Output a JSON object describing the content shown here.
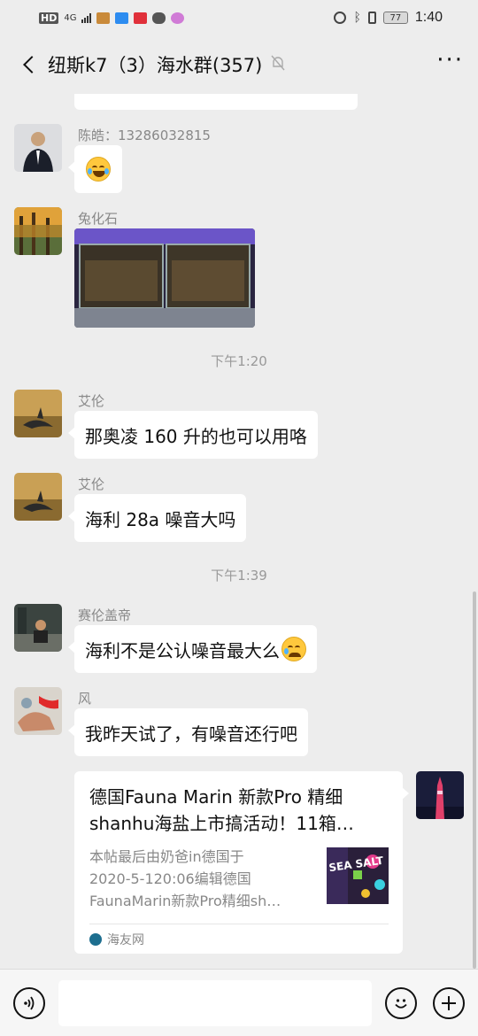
{
  "status_bar": {
    "network_label": "HD",
    "signal_label": "4G",
    "battery": "77",
    "time": "1:40"
  },
  "header": {
    "title": "纽斯k7（3）海水群(357)",
    "back_icon": "chevron-left-icon",
    "mute_icon": "bell-muted-icon",
    "more_icon": "ellipsis-icon"
  },
  "messages": {
    "m1": {
      "sender": "陈皓：13286032815",
      "type": "emoji",
      "emoji": "laugh-tears"
    },
    "m2": {
      "sender": "兔化石",
      "type": "image"
    },
    "time1": "下午1:20",
    "m3": {
      "sender": "艾伦",
      "text": "那奥凌 160 升的也可以用咯"
    },
    "m4": {
      "sender": "艾伦",
      "text": "海利 28a 噪音大吗"
    },
    "time2": "下午1:39",
    "m5": {
      "sender": "赛伦盖帝",
      "text": "海利不是公认噪音最大么",
      "emoji": "crying"
    },
    "m6": {
      "sender": "风",
      "text": "我昨天试了，有噪音还行吧"
    },
    "m7": {
      "type": "link",
      "title_line1": "德国Fauna Marin 新款Pro 精细",
      "title_line2": "shanhu海盐上市搞活动！11箱…",
      "desc_line1": "本帖最后由奶爸in德国于",
      "desc_line2": "2020-5-120:06编辑德国",
      "desc_line3": "FaunaMarin新款Pro精细sh…",
      "source": "海友网",
      "thumb_text": "SEA SALT"
    }
  },
  "input_bar": {
    "voice_icon": "voice-icon",
    "emoji_icon": "smiley-icon",
    "plus_icon": "plus-icon",
    "placeholder": ""
  },
  "colors": {
    "background": "#ededed",
    "bubble": "#ffffff",
    "meta_text": "#888888"
  }
}
